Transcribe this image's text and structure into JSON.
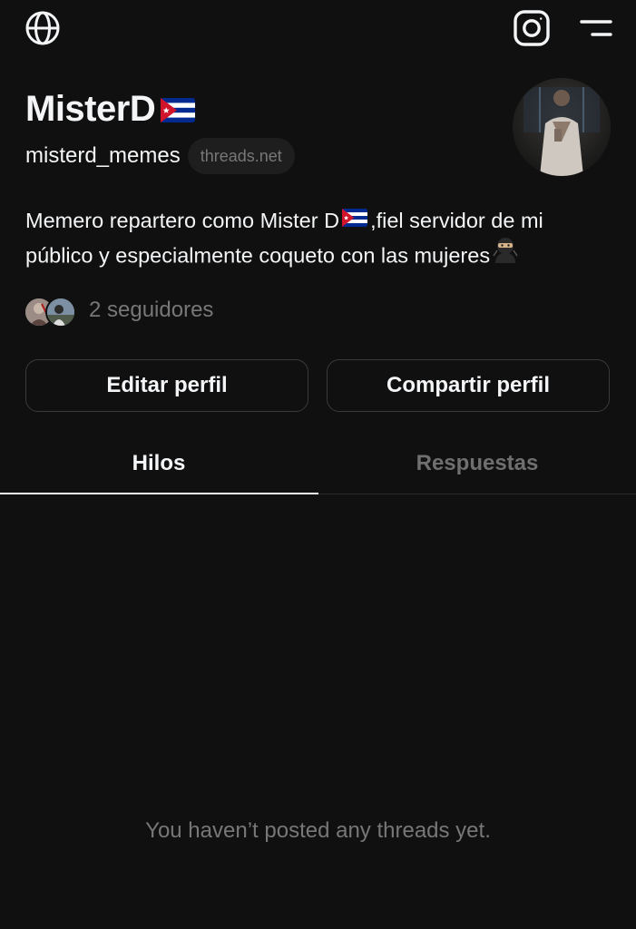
{
  "topbar": {
    "left_icon": "globe-icon",
    "right_icons": [
      "instagram-icon",
      "menu-icon"
    ]
  },
  "profile": {
    "display_name": "MisterD",
    "name_emoji": "cuba-flag",
    "handle": "misterd_memes",
    "domain_badge": "threads.net",
    "bio_part1": "Memero repartero como Mister D",
    "bio_part2": ",fiel servidor de mi público y especialmente coqueto con las mujeres",
    "bio_emojis": [
      "cuba-flag",
      "ninja"
    ],
    "followers_text": "2 seguidores"
  },
  "actions": {
    "edit_label": "Editar perfil",
    "share_label": "Compartir perfil"
  },
  "tabs": [
    {
      "label": "Hilos",
      "active": true
    },
    {
      "label": "Respuestas",
      "active": false
    }
  ],
  "empty_state": "You haven’t posted any threads yet.",
  "colors": {
    "background": "#101010",
    "text_primary": "#f3f5f7",
    "text_secondary": "#777777",
    "border": "#3a3a3a",
    "flag_blue": "#002a8f",
    "flag_red": "#cf142b"
  }
}
